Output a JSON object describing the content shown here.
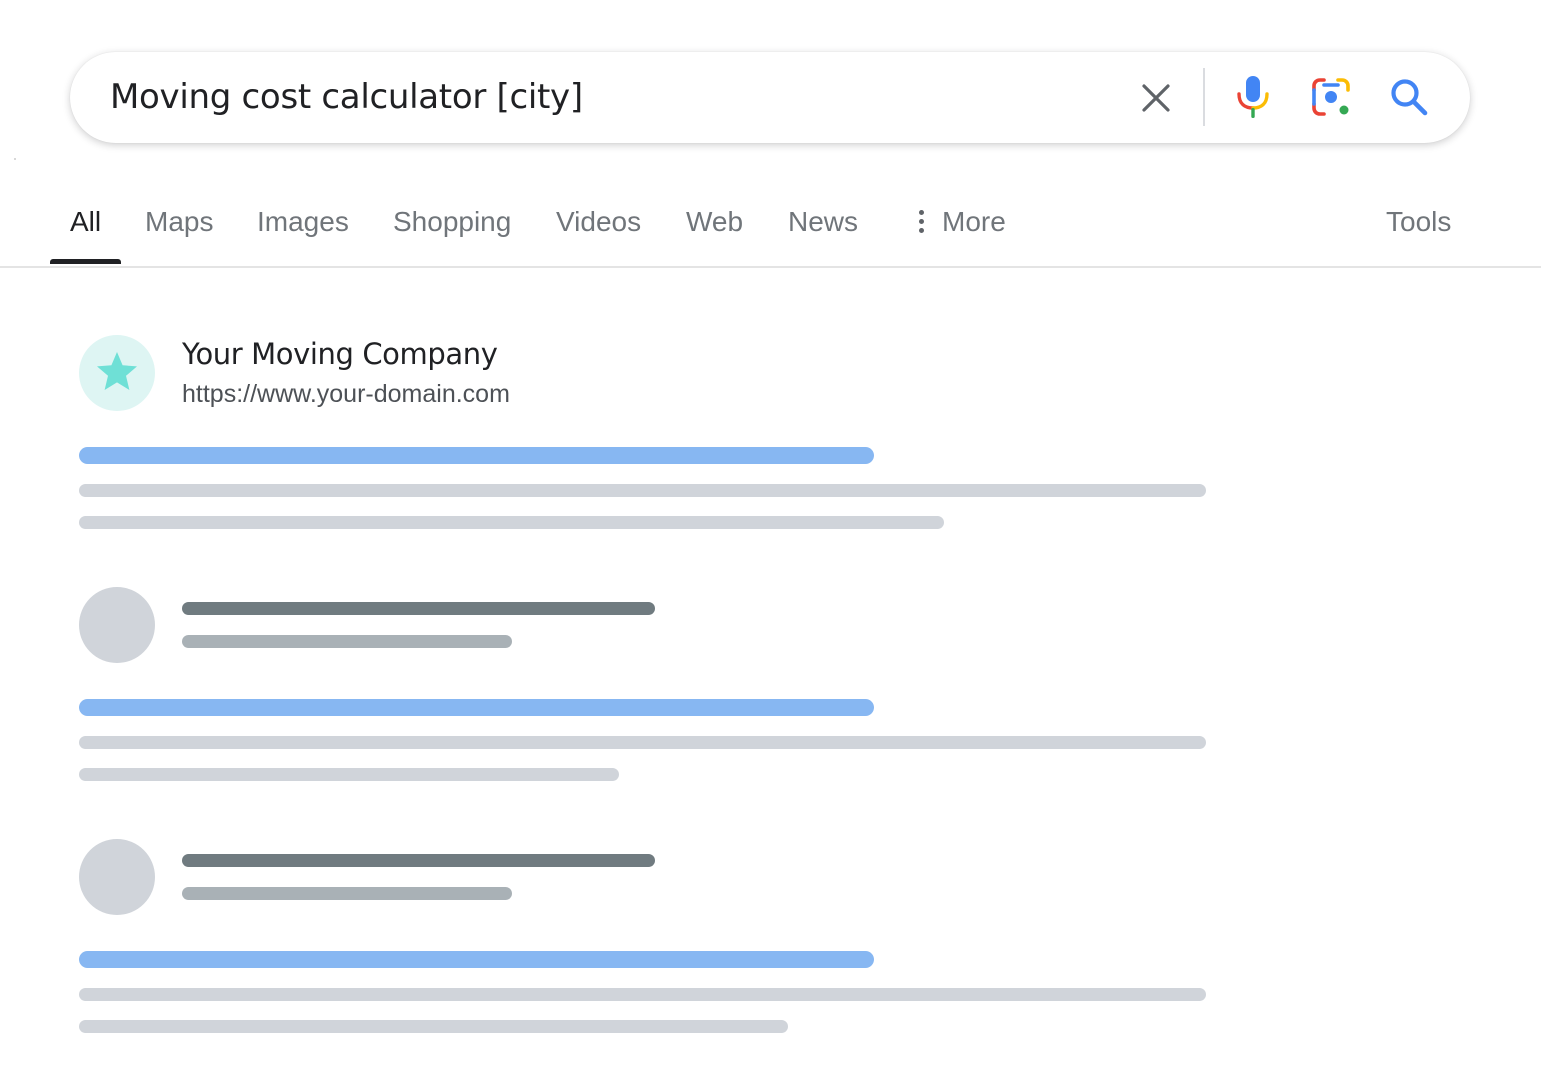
{
  "search": {
    "query": "Moving cost calculator [city]",
    "clear_icon": "close-icon",
    "voice_icon": "microphone-icon",
    "lens_icon": "camera-lens-icon",
    "submit_icon": "magnifier-icon"
  },
  "tabs": [
    {
      "label": "All",
      "active": true
    },
    {
      "label": "Maps"
    },
    {
      "label": "Images"
    },
    {
      "label": "Shopping"
    },
    {
      "label": "Videos"
    },
    {
      "label": "Web"
    },
    {
      "label": "News"
    },
    {
      "label": "More"
    }
  ],
  "tools_label": "Tools",
  "featured_result": {
    "site_name": "Your Moving Company",
    "url": "https://www.your-domain.com",
    "favicon_icon": "star-icon"
  },
  "colors": {
    "accent_blue": "#4285f4",
    "title_placeholder": "#87b7f2",
    "snippet_placeholder": "#d0d4da",
    "favicon_teal": "#6fe0d6"
  }
}
